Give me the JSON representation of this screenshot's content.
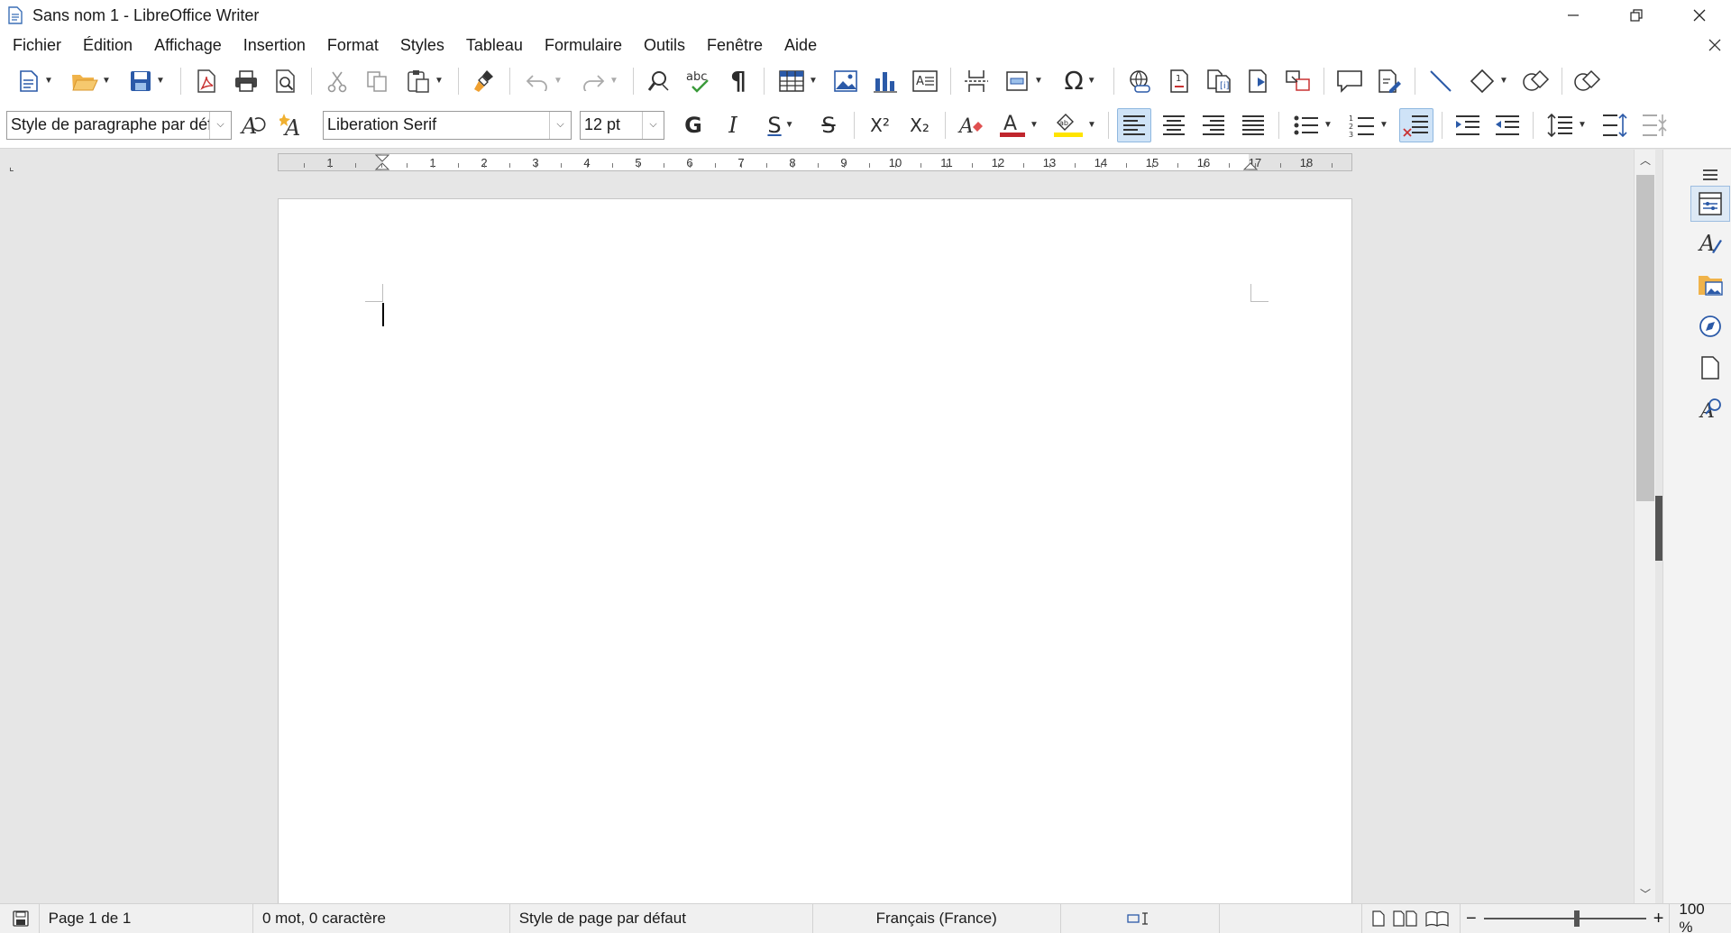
{
  "window": {
    "title": "Sans nom 1 - LibreOffice Writer"
  },
  "menu": {
    "items": [
      "Fichier",
      "Édition",
      "Affichage",
      "Insertion",
      "Format",
      "Styles",
      "Tableau",
      "Formulaire",
      "Outils",
      "Fenêtre",
      "Aide"
    ]
  },
  "formatting": {
    "paragraph_style": "Style de paragraphe par déf.",
    "font_name": "Liberation Serif",
    "font_size": "12 pt",
    "bold_glyph": "G",
    "italic_glyph": "I",
    "underline_glyph": "S",
    "strike_glyph": "S",
    "superscript_glyph": "X²",
    "subscript_glyph": "X₂",
    "font_color": "#c0262d",
    "highlight_color": "#ffe400"
  },
  "ruler": {
    "labels": [
      "1",
      "1",
      "2",
      "3",
      "4",
      "5",
      "6",
      "7",
      "8",
      "9",
      "10",
      "11",
      "12",
      "13",
      "14",
      "15",
      "16",
      "17",
      "18"
    ]
  },
  "status": {
    "page": "Page 1 de 1",
    "words": "0 mot, 0 caractère",
    "page_style": "Style de page par défaut",
    "language": "Français (France)",
    "zoom": "100 %"
  },
  "colors": {
    "accent": "#3a7fd5",
    "active_button": "#cfe3f7"
  }
}
